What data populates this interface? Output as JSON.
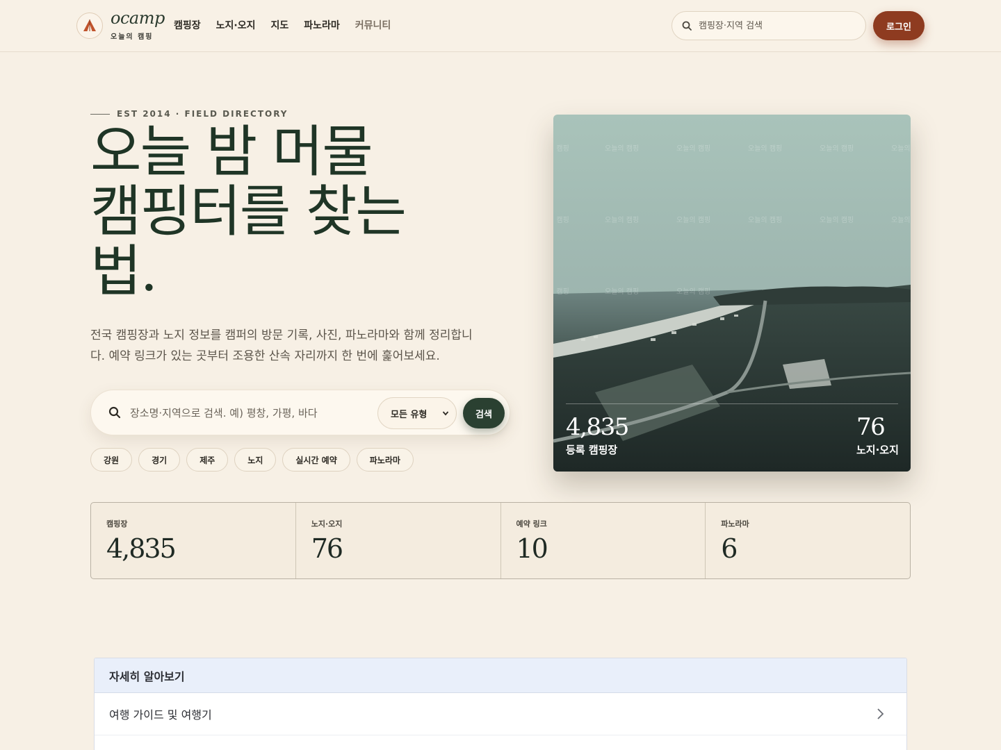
{
  "header": {
    "logo_word": "ocamp",
    "logo_sub": "오늘의 캠핑",
    "nav": [
      {
        "label": "캠핑장",
        "muted": false
      },
      {
        "label": "노지·오지",
        "muted": false
      },
      {
        "label": "지도",
        "muted": false
      },
      {
        "label": "파노라마",
        "muted": false
      },
      {
        "label": "커뮤니티",
        "muted": true
      }
    ],
    "search_placeholder": "캠핑장·지역 검색",
    "login_label": "로그인"
  },
  "hero": {
    "eyebrow": "EST 2014 · FIELD DIRECTORY",
    "title_line1": "오늘 밤 머물",
    "title_line2": "캠핑터를 찾는",
    "title_line3": "법.",
    "description": "전국 캠핑장과 노지 정보를 캠퍼의 방문 기록, 사진, 파노라마와 함께 정리합니다. 예약 링크가 있는 곳부터 조용한 산속 자리까지 한 번에 훑어보세요.",
    "search_placeholder": "장소명·지역으로 검색. 예) 평창, 가평, 바다",
    "type_select": "모든 유형",
    "search_button": "검색",
    "chips": [
      "강원",
      "경기",
      "제주",
      "노지",
      "실시간 예약",
      "파노라마"
    ]
  },
  "photo": {
    "watermark": "오늘의 캠핑",
    "left_value": "4,835",
    "left_label": "등록 캠핑장",
    "right_value": "76",
    "right_label": "노지·오지"
  },
  "stats": [
    {
      "label": "캠핑장",
      "value": "4,835"
    },
    {
      "label": "노지·오지",
      "value": "76"
    },
    {
      "label": "예약 링크",
      "value": "10"
    },
    {
      "label": "파노라마",
      "value": "6"
    }
  ],
  "learn_more": {
    "title": "자세히 알아보기",
    "items": [
      "여행 가이드 및 여행기"
    ]
  },
  "colors": {
    "background": "#f7f0e5",
    "brand_green": "#2a4031",
    "accent_rust": "#8e3b20"
  }
}
